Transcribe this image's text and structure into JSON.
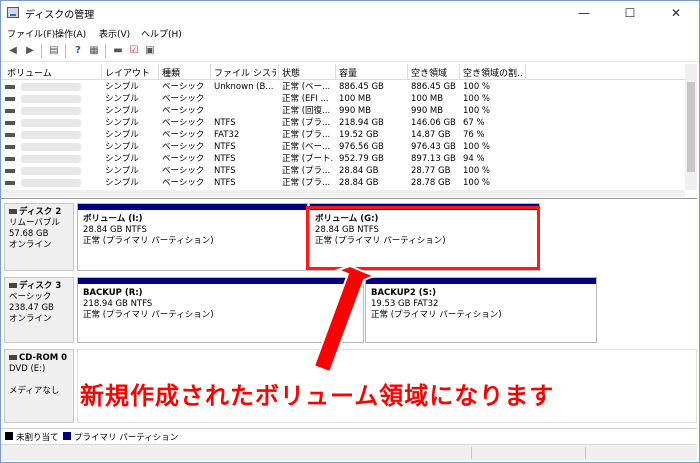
{
  "window": {
    "title": "ディスクの管理",
    "minimize": "—",
    "maximize": "☐",
    "close": "✕"
  },
  "menu": [
    "ファイル(F)",
    "操作(A)",
    "表示(V)",
    "ヘルプ(H)"
  ],
  "toolbar_icons": [
    "back-arrow-icon",
    "forward-arrow-icon",
    "console-tree-icon",
    "help-icon",
    "list-view-icon",
    "disk-icon",
    "check-icon",
    "settings-icon"
  ],
  "table": {
    "columns": [
      "ボリューム",
      "レイアウト",
      "種類",
      "ファイル システム",
      "状態",
      "容量",
      "空き領域",
      "空き領域の割..."
    ],
    "rows": [
      [
        "",
        "シンプル",
        "ベーシック",
        "Unknown (B...",
        "正常 (ベー...",
        "886.45 GB",
        "886.45 GB",
        "100 %"
      ],
      [
        "",
        "シンプル",
        "ベーシック",
        "",
        "正常 (EFI ...",
        "100 MB",
        "100 MB",
        "100 %"
      ],
      [
        "",
        "シンプル",
        "ベーシック",
        "",
        "正常 (回復...",
        "990 MB",
        "990 MB",
        "100 %"
      ],
      [
        "",
        "シンプル",
        "ベーシック",
        "NTFS",
        "正常 (プラ...",
        "218.94 GB",
        "146.06 GB",
        "67 %"
      ],
      [
        "",
        "シンプル",
        "ベーシック",
        "FAT32",
        "正常 (プラ...",
        "19.52 GB",
        "14.87 GB",
        "76 %"
      ],
      [
        "",
        "シンプル",
        "ベーシック",
        "NTFS",
        "正常 (ベー...",
        "976.56 GB",
        "976.43 GB",
        "100 %"
      ],
      [
        "",
        "シンプル",
        "ベーシック",
        "NTFS",
        "正常 (ブート...",
        "952.79 GB",
        "897.13 GB",
        "94 %"
      ],
      [
        "",
        "シンプル",
        "ベーシック",
        "NTFS",
        "正常 (プラ...",
        "28.84 GB",
        "28.77 GB",
        "100 %"
      ],
      [
        "",
        "シンプル",
        "ベーシック",
        "NTFS",
        "正常 (プラ...",
        "28.84 GB",
        "28.78 GB",
        "100 %"
      ]
    ]
  },
  "disks": [
    {
      "name": "ディスク 2",
      "type": "リムーバブル",
      "size": "57.68 GB",
      "state": "オンライン",
      "partitions": [
        {
          "title": "ボリューム (I:)",
          "fs": "28.84 GB NTFS",
          "status": "正常 (プライマリ パーティション)"
        },
        {
          "title": "ボリューム (G:)",
          "fs": "28.84 GB NTFS",
          "status": "正常 (プライマリ パーティション)"
        }
      ]
    },
    {
      "name": "ディスク 3",
      "type": "ベーシック",
      "size": "238.47 GB",
      "state": "オンライン",
      "partitions": [
        {
          "title": "BACKUP (R:)",
          "fs": "218.94 GB NTFS",
          "status": "正常 (プライマリ パーティション)"
        },
        {
          "title": "BACKUP2 (S:)",
          "fs": "19.53 GB FAT32",
          "status": "正常 (プライマリ パーティション)"
        }
      ]
    },
    {
      "name": "CD-ROM 0",
      "type": "DVD (E:)",
      "size": "",
      "state": "メディアなし",
      "partitions": []
    }
  ],
  "legend": [
    "未割り当て",
    "プライマリ パーティション"
  ],
  "colors": {
    "primary_partition": "#000080",
    "unallocated": "#000000",
    "annotation": "#ff0000"
  },
  "annotation": "新規作成されたボリューム領域になります"
}
